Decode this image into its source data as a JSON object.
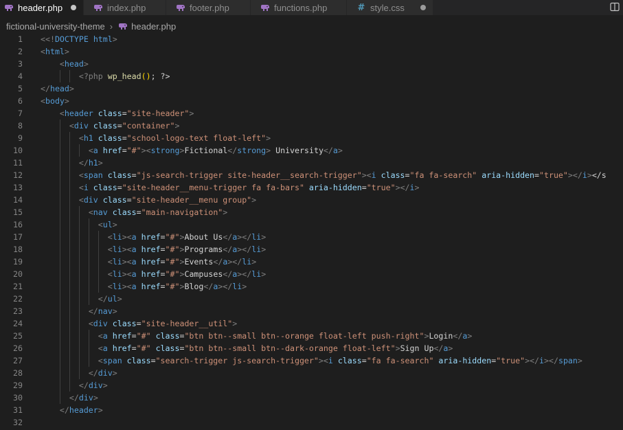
{
  "tabs": [
    {
      "label": "header.php",
      "icon": "php-elephant-icon",
      "active": true,
      "modified": true
    },
    {
      "label": "index.php",
      "icon": "php-elephant-icon",
      "active": false,
      "modified": false
    },
    {
      "label": "footer.php",
      "icon": "php-elephant-icon",
      "active": false,
      "modified": false
    },
    {
      "label": "functions.php",
      "icon": "php-elephant-icon",
      "active": false,
      "modified": false
    },
    {
      "label": "style.css",
      "icon": "hash-icon",
      "icon_glyph": "#",
      "active": false,
      "modified": true
    }
  ],
  "breadcrumb": {
    "folder": "fictional-university-theme",
    "separator": "›",
    "file": "header.php"
  },
  "colors": {
    "tag": "#569cd6",
    "attribute": "#9cdcfe",
    "string": "#ce9178",
    "function": "#dcdcaa",
    "text": "#d4d4d4",
    "punctuation": "#808080",
    "php_icon": "#a074c4",
    "css_icon": "#519aba"
  },
  "editor": {
    "lines": [
      {
        "n": "1",
        "code": "<!DOCTYPE html>"
      },
      {
        "n": "2",
        "code": "<html>"
      },
      {
        "n": "3",
        "code": "    <head>"
      },
      {
        "n": "4",
        "code": "        <?php wp_head(); ?>"
      },
      {
        "n": "5",
        "code": "</head>"
      },
      {
        "n": "6",
        "code": "<body>"
      },
      {
        "n": "7",
        "code": "    <header class=\"site-header\">"
      },
      {
        "n": "8",
        "code": "      <div class=\"container\">"
      },
      {
        "n": "9",
        "code": "        <h1 class=\"school-logo-text float-left\">"
      },
      {
        "n": "10",
        "code": "          <a href=\"#\"><strong>Fictional</strong> University</a>"
      },
      {
        "n": "11",
        "code": "        </h1>"
      },
      {
        "n": "12",
        "code": "        <span class=\"js-search-trigger site-header__search-trigger\"><i class=\"fa fa-search\" aria-hidden=\"true\"></i></s"
      },
      {
        "n": "13",
        "code": "        <i class=\"site-header__menu-trigger fa fa-bars\" aria-hidden=\"true\"></i>"
      },
      {
        "n": "14",
        "code": "        <div class=\"site-header__menu group\">"
      },
      {
        "n": "15",
        "code": "          <nav class=\"main-navigation\">"
      },
      {
        "n": "16",
        "code": "            <ul>"
      },
      {
        "n": "17",
        "code": "              <li><a href=\"#\">About Us</a></li>"
      },
      {
        "n": "18",
        "code": "              <li><a href=\"#\">Programs</a></li>"
      },
      {
        "n": "19",
        "code": "              <li><a href=\"#\">Events</a></li>"
      },
      {
        "n": "20",
        "code": "              <li><a href=\"#\">Campuses</a></li>"
      },
      {
        "n": "21",
        "code": "              <li><a href=\"#\">Blog</a></li>"
      },
      {
        "n": "22",
        "code": "            </ul>"
      },
      {
        "n": "23",
        "code": "          </nav>"
      },
      {
        "n": "24",
        "code": "          <div class=\"site-header__util\">"
      },
      {
        "n": "25",
        "code": "            <a href=\"#\" class=\"btn btn--small btn--orange float-left push-right\">Login</a>"
      },
      {
        "n": "26",
        "code": "            <a href=\"#\" class=\"btn btn--small btn--dark-orange float-left\">Sign Up</a>"
      },
      {
        "n": "27",
        "code": "            <span class=\"search-trigger js-search-trigger\"><i class=\"fa fa-search\" aria-hidden=\"true\"></i></span>"
      },
      {
        "n": "28",
        "code": "          </div>"
      },
      {
        "n": "29",
        "code": "        </div>"
      },
      {
        "n": "30",
        "code": "      </div>"
      },
      {
        "n": "31",
        "code": "    </header>"
      },
      {
        "n": "32",
        "code": ""
      }
    ]
  }
}
